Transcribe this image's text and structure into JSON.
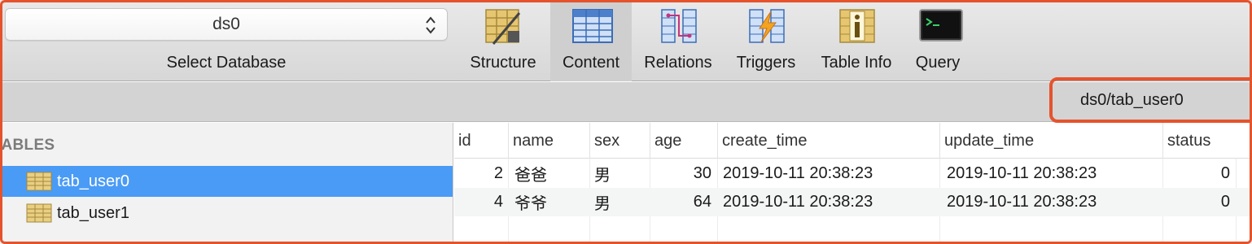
{
  "database_selector": {
    "value": "ds0",
    "label": "Select Database"
  },
  "toolbar": {
    "items": [
      {
        "label": "Structure",
        "icon": "structure-icon"
      },
      {
        "label": "Content",
        "icon": "content-icon",
        "active": true
      },
      {
        "label": "Relations",
        "icon": "relations-icon"
      },
      {
        "label": "Triggers",
        "icon": "triggers-icon"
      },
      {
        "label": "Table Info",
        "icon": "table-info-icon"
      },
      {
        "label": "Query",
        "icon": "query-icon"
      }
    ]
  },
  "path": "ds0/tab_user0",
  "sidebar": {
    "heading": "TABLES",
    "items": [
      {
        "label": "tab_user0",
        "selected": true
      },
      {
        "label": "tab_user1",
        "selected": false
      }
    ]
  },
  "table": {
    "columns": [
      "id",
      "name",
      "sex",
      "age",
      "create_time",
      "update_time",
      "status"
    ],
    "rows": [
      [
        "2",
        "爸爸",
        "男",
        "30",
        "2019-10-11 20:38:23",
        "2019-10-11 20:38:23",
        "0"
      ],
      [
        "4",
        "爷爷",
        "男",
        "64",
        "2019-10-11 20:38:23",
        "2019-10-11 20:38:23",
        "0"
      ]
    ]
  },
  "colors": {
    "highlight": "#e5532d",
    "selection": "#4a9bf5"
  }
}
